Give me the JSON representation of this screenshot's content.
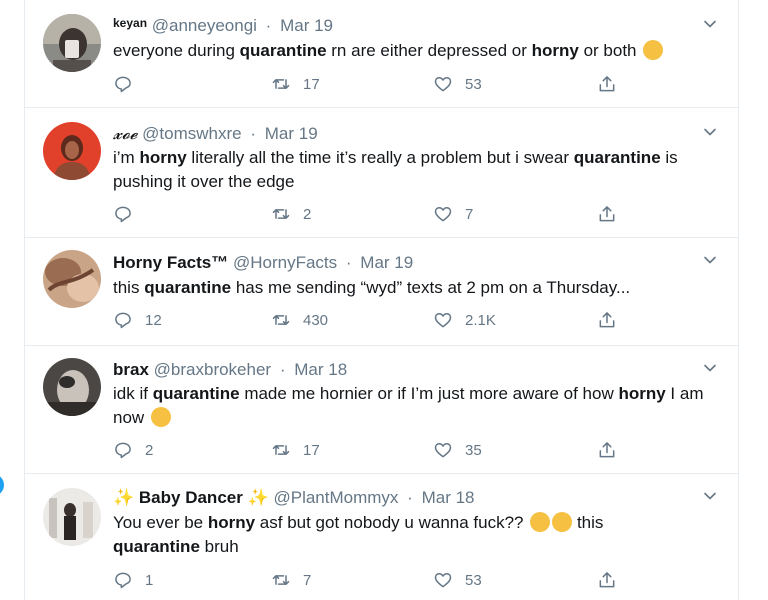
{
  "tweets": [
    {
      "name": "keyan",
      "handle": "@anneyeongi",
      "date": "Mar 19",
      "text": [
        "everyone during ",
        "quarantine",
        " rn are either depressed or ",
        "horny",
        " or both"
      ],
      "replies": "",
      "retweets": "17",
      "likes": "53"
    },
    {
      "name": "𝔁𝓸𝓮",
      "handle": "@tomswhxre",
      "date": "Mar 19",
      "text": [
        "i’m ",
        "horny",
        " literally all the time it’s really a problem but i swear ",
        "quarantine",
        " is pushing it over the edge"
      ],
      "replies": "",
      "retweets": "2",
      "likes": "7"
    },
    {
      "name": "Horny Facts™",
      "handle": "@HornyFacts",
      "date": "Mar 19",
      "text": [
        "this ",
        "quarantine",
        " has me sending “wyd” texts at 2 pm on a Thursday..."
      ],
      "replies": "12",
      "retweets": "430",
      "likes": "2.1K"
    },
    {
      "name": "brax",
      "handle": "@braxbrokeher",
      "date": "Mar 18",
      "text": [
        "idk if ",
        "quarantine",
        " made me hornier or if I’m just more aware of how ",
        "horny",
        " I am now"
      ],
      "replies": "2",
      "retweets": "17",
      "likes": "35"
    },
    {
      "name": "Baby Dancer",
      "handle": "@PlantMommyx",
      "date": "Mar 18",
      "text": [
        "You ever be ",
        "horny",
        " asf but got nobody u wanna fuck?? ",
        "",
        " this ",
        "quarantine",
        " bruh"
      ],
      "replies": "1",
      "retweets": "7",
      "likes": "53"
    }
  ],
  "colors": {
    "accent": "#1da1f2",
    "muted": "#657786",
    "text": "#14171a",
    "border": "#e6ecf0"
  }
}
